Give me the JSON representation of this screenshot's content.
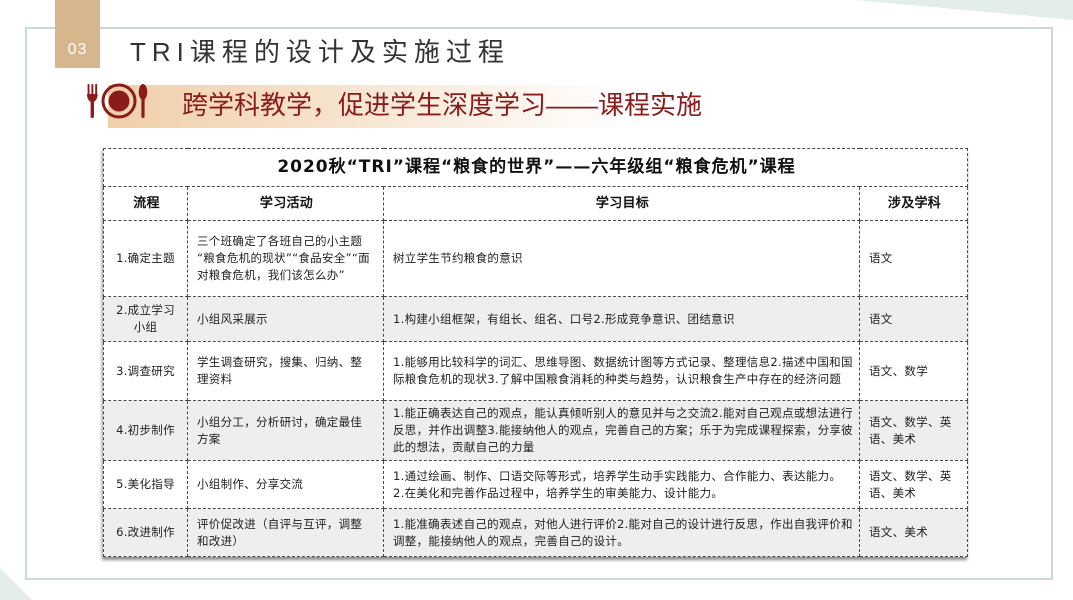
{
  "slide": {
    "number": "03",
    "title": "TRI课程的设计及实施过程",
    "subtitle": "跨学科教学，促进学生深度学习——课程实施",
    "icon": "fork-plate-spoon-icon",
    "colors": {
      "accent": "#8b1c1c",
      "tan": "#d6b68d",
      "frame": "#c8dccf",
      "band": "#f0cfa9",
      "row_shade": "#eeeeee"
    }
  },
  "table": {
    "title": "2020秋“TRI”课程“粮食的世界”——六年级组“粮食危机”课程",
    "headers": [
      "流程",
      "学习活动",
      "学习目标",
      "涉及学科"
    ],
    "rows": [
      {
        "step": "1.确定主题",
        "activity": "三个班确定了各班自己的小主题“粮食危机的现状”“食品安全”“面对粮食危机，我们该怎么办”",
        "goal": "树立学生节约粮食的意识",
        "subjects": "语文"
      },
      {
        "step": "2.成立学习小组",
        "activity": "小组风采展示",
        "goal": "1.构建小组框架，有组长、组名、口号2.形成竞争意识、团结意识",
        "subjects": "语文"
      },
      {
        "step": "3.调查研究",
        "activity": "学生调查研究，搜集、归纳、整理资料",
        "goal": "1.能够用比较科学的词汇、思维导图、数据统计图等方式记录、整理信息2.描述中国和国际粮食危机的现状3.了解中国粮食消耗的种类与趋势，认识粮食生产中存在的经济问题",
        "subjects": "语文、数学"
      },
      {
        "step": "4.初步制作",
        "activity": "小组分工，分析研讨，确定最佳方案",
        "goal": "1.能正确表达自己的观点，能认真倾听别人的意见并与之交流2.能对自己观点或想法进行反思，并作出调整3.能接纳他人的观点，完善自己的方案；乐于为完成课程探索，分享彼此的想法，贡献自己的力量",
        "subjects": "语文、数学、英语、美术"
      },
      {
        "step": "5.美化指导",
        "activity": "小组制作、分享交流",
        "goal": "1.通过绘画、制作、口语交际等形式，培养学生动手实践能力、合作能力、表达能力。\n2.在美化和完善作品过程中，培养学生的审美能力、设计能力。",
        "subjects": "语文、数学、英语、美术"
      },
      {
        "step": "6.改进制作",
        "activity": "评价促改进（自评与互评，调整和改进）",
        "goal": "1.能准确表述自己的观点，对他人进行评价2.能对自己的设计进行反思，作出自我评价和调整，能接纳他人的观点，完善自己的设计。",
        "subjects": "语文、美术"
      }
    ]
  }
}
